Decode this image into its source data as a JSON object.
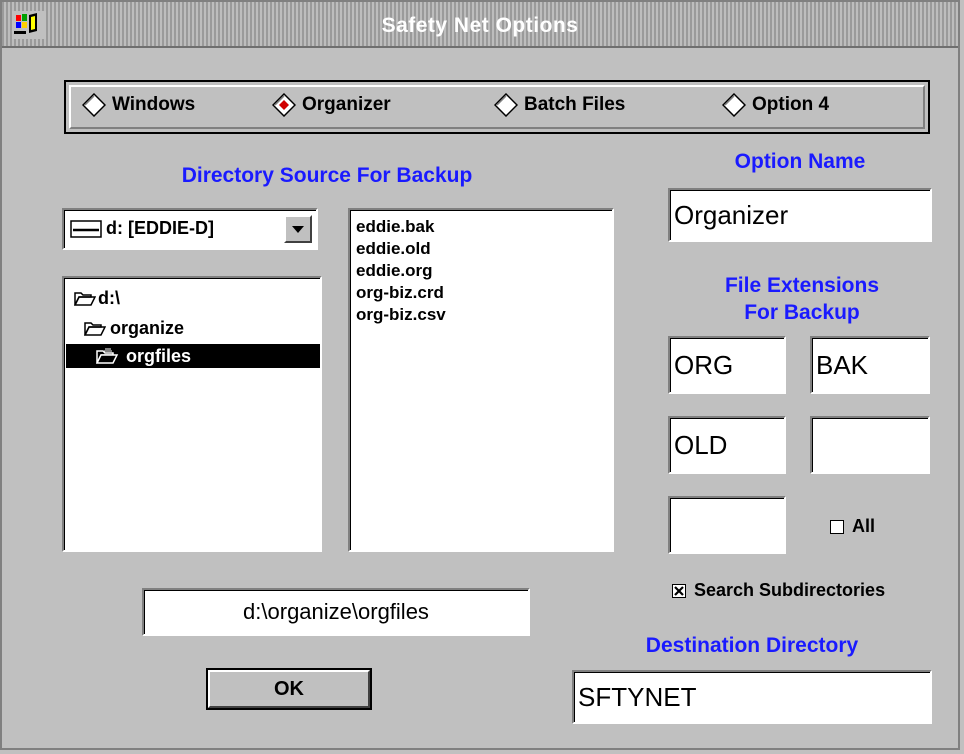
{
  "window": {
    "title": "Safety Net Options"
  },
  "options": [
    {
      "label": "Windows",
      "selected": false
    },
    {
      "label": "Organizer",
      "selected": true
    },
    {
      "label": "Batch Files",
      "selected": false
    },
    {
      "label": "Option 4",
      "selected": false
    }
  ],
  "directory_source": {
    "heading": "Directory Source For Backup",
    "drive": "d: [EDDIE-D]",
    "tree": [
      "d:\\",
      "organize",
      "orgfiles"
    ],
    "files": [
      "eddie.bak",
      "eddie.old",
      "eddie.org",
      "org-biz.crd",
      "org-biz.csv"
    ],
    "current_path": "d:\\organize\\orgfiles"
  },
  "option_name": {
    "heading": "Option Name",
    "value": "Organizer"
  },
  "extensions": {
    "heading_line1": "File Extensions",
    "heading_line2": "For Backup",
    "values": [
      "ORG",
      "BAK",
      "OLD",
      "",
      ""
    ],
    "all_label": "All",
    "all_checked": false
  },
  "search_subdirectories": {
    "label": "Search Subdirectories",
    "checked": true
  },
  "destination": {
    "heading": "Destination Directory",
    "value": "SFTYNET"
  },
  "ok_label": "OK",
  "colors": {
    "accent_text": "#1a1aff",
    "selection_bg": "#000000",
    "radio_dot": "#d00000"
  }
}
